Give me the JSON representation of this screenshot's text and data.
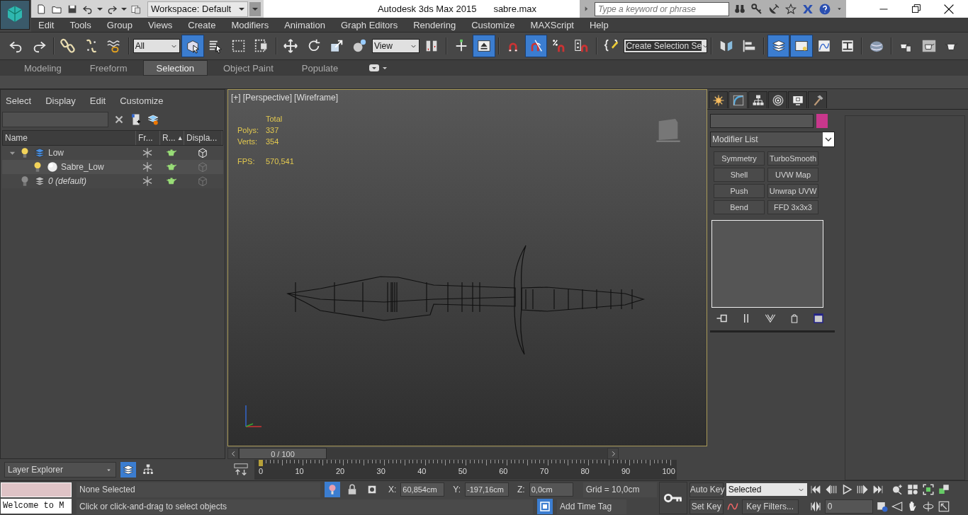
{
  "title_bar": {
    "workspace": "Workspace: Default",
    "title": "Autodesk 3ds Max  2015",
    "file": "sabre.max",
    "search": {
      "placeholder": "Type a keyword or phrase"
    }
  },
  "menu": [
    "Edit",
    "Tools",
    "Group",
    "Views",
    "Create",
    "Modifiers",
    "Animation",
    "Graph Editors",
    "Rendering",
    "Customize",
    "MAXScript",
    "Help"
  ],
  "toolbar": [
    {
      "kind": "button",
      "on": false
    },
    {
      "kind": "button",
      "on": false
    },
    {
      "kind": "separator"
    },
    {
      "kind": "button",
      "on": false
    },
    {
      "kind": "button",
      "on": false
    },
    {
      "kind": "button",
      "on": false
    },
    {
      "kind": "separator"
    },
    {
      "kind": "dropdown",
      "value": "All"
    },
    {
      "kind": "button",
      "on": true
    },
    {
      "kind": "button",
      "on": false
    },
    {
      "kind": "button",
      "on": false
    },
    {
      "kind": "button",
      "on": false
    },
    {
      "kind": "separator"
    },
    {
      "kind": "button",
      "on": false
    },
    {
      "kind": "button",
      "on": false
    },
    {
      "kind": "button",
      "on": false
    },
    {
      "kind": "button",
      "on": false
    },
    {
      "kind": "dropdown",
      "value": "View"
    },
    {
      "kind": "button",
      "on": false
    },
    {
      "kind": "separator"
    },
    {
      "kind": "button",
      "on": false
    },
    {
      "kind": "button",
      "on": true
    },
    {
      "kind": "separator"
    },
    {
      "kind": "button",
      "on": false
    },
    {
      "kind": "button",
      "on": true
    },
    {
      "kind": "button",
      "on": false
    },
    {
      "kind": "button",
      "on": false
    },
    {
      "kind": "separator"
    },
    {
      "kind": "button",
      "on": false
    },
    {
      "kind": "dropdown",
      "value": "Create Selection Se"
    },
    {
      "kind": "separator"
    },
    {
      "kind": "button",
      "on": false
    },
    {
      "kind": "button",
      "on": false
    },
    {
      "kind": "separator"
    },
    {
      "kind": "button",
      "on": true
    },
    {
      "kind": "button",
      "on": true
    },
    {
      "kind": "button",
      "on": false
    },
    {
      "kind": "button",
      "on": false
    },
    {
      "kind": "separator"
    },
    {
      "kind": "button",
      "on": false
    },
    {
      "kind": "separator"
    },
    {
      "kind": "button",
      "on": false
    },
    {
      "kind": "button",
      "on": false
    },
    {
      "kind": "button",
      "on": false
    }
  ],
  "ribbon_tabs": [
    {
      "label": "Modeling",
      "selected": false
    },
    {
      "label": "Freeform",
      "selected": false
    },
    {
      "label": "Selection",
      "selected": true
    },
    {
      "label": "Object Paint",
      "selected": false
    },
    {
      "label": "Populate",
      "selected": false
    }
  ],
  "scene_explorer": {
    "menu": [
      "Select",
      "Display",
      "Edit",
      "Customize"
    ],
    "columns": [
      "Name",
      "Fr...",
      "R...",
      "Displa..."
    ],
    "sort_mark": "▲",
    "tree": [
      {
        "name": "Low",
        "kind": "layer",
        "visible": true,
        "is_default": false,
        "expanded": true,
        "children": [
          {
            "name": "Sabre_Low",
            "kind": "object",
            "visible": true,
            "is_default": false
          }
        ]
      },
      {
        "name": "0 (default)",
        "kind": "layer",
        "visible": false,
        "is_default": true
      }
    ],
    "explorer": "Layer Explorer",
    "modes": [
      {
        "kind": "layers",
        "selected": true
      },
      {
        "kind": "hierarchy",
        "selected": false
      }
    ]
  },
  "viewport": {
    "labels": [
      "[+]",
      "[Perspective]",
      "[Wireframe]"
    ],
    "active": true,
    "stats_header": "Total",
    "stats": [
      {
        "label": "Polys:",
        "value": "337"
      },
      {
        "label": "Verts:",
        "value": "354"
      }
    ],
    "fps_label": "FPS:",
    "fps": "570,541"
  },
  "timeline": {
    "frame": "0 / 100",
    "level": 0,
    "ticks": [
      "0",
      "10",
      "20",
      "30",
      "40",
      "50",
      "60",
      "70",
      "80",
      "90",
      "100"
    ]
  },
  "command_panel": {
    "tabs": [
      {
        "kind": "create",
        "selected": false
      },
      {
        "kind": "modify",
        "selected": true
      },
      {
        "kind": "hierarchy",
        "selected": false
      },
      {
        "kind": "motion",
        "selected": false
      },
      {
        "kind": "display",
        "selected": false
      },
      {
        "kind": "utilities",
        "selected": false
      }
    ],
    "modifier_list": "Modifier List",
    "modifiers": [
      "Symmetry",
      "TurboSmooth",
      "Shell",
      "UVW Map",
      "Push",
      "Unwrap UVW",
      "Bend",
      "FFD 3x3x3"
    ]
  },
  "status": {
    "listener_output": "Welcome to M",
    "selection": "None Selected",
    "prompt": "Click or click-and-drag to select objects",
    "isolate_on": true,
    "coords": [
      {
        "label": "X:",
        "value": "60,854cm"
      },
      {
        "label": "Y:",
        "value": "-197,16cm"
      },
      {
        "label": "Z:",
        "value": "0,0cm"
      }
    ],
    "grid": "Grid = 10,0cm",
    "time_tag": "Add Time Tag",
    "auto_key": "Auto Key",
    "set_key": "Set Key",
    "key_mode": "Selected",
    "key_filters": "Key Filters...",
    "frame": "0"
  }
}
